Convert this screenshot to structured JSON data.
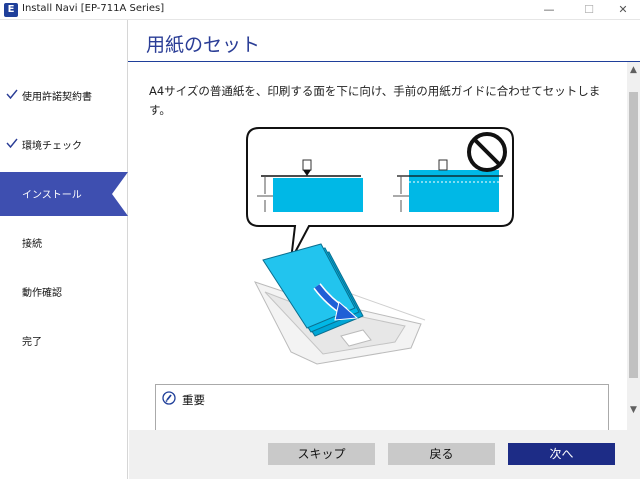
{
  "window": {
    "title": "Install Navi [EP-711A Series]",
    "app_icon_letter": "E",
    "minimize": "—",
    "maximize": "☐",
    "close": "✕"
  },
  "sidebar": {
    "items": [
      {
        "label": "使用許諾契約書",
        "state": "done"
      },
      {
        "label": "環境チェック",
        "state": "done"
      },
      {
        "label": "インストール",
        "state": "active"
      },
      {
        "label": "接続",
        "state": "pending"
      },
      {
        "label": "動作確認",
        "state": "pending"
      },
      {
        "label": "完了",
        "state": "pending"
      }
    ]
  },
  "main": {
    "title": "用紙のセット",
    "instruction": "A4サイズの普通紙を、印刷する面を下に向け、手前の用紙ガイドに合わせてセットします。",
    "notice_label": "重要"
  },
  "footer": {
    "skip_label": "スキップ",
    "back_label": "戻る",
    "next_label": "次へ"
  },
  "colors": {
    "brand": "#1f3f9a",
    "active_step": "#3e4fb0",
    "paper": "#00b8e6",
    "next_button": "#1d2c86"
  }
}
